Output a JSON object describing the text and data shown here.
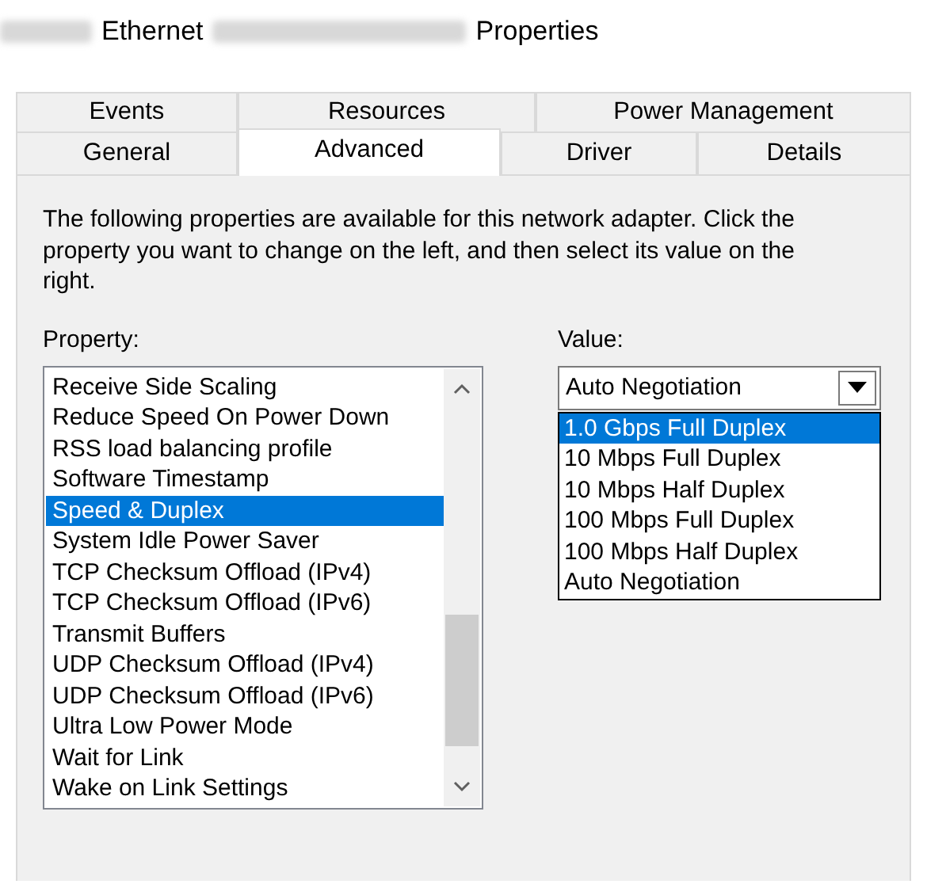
{
  "window": {
    "title_parts": [
      {
        "kind": "redacted"
      },
      {
        "kind": "text",
        "text": "Ethernet"
      },
      {
        "kind": "redacted"
      },
      {
        "kind": "text",
        "text": "Properties"
      }
    ]
  },
  "tab_rows": [
    [
      {
        "label": "Events",
        "selected": false
      },
      {
        "label": "Resources",
        "selected": false
      },
      {
        "label": "Power Management",
        "selected": false
      }
    ],
    [
      {
        "label": "General",
        "selected": false
      },
      {
        "label": "Advanced",
        "selected": true
      },
      {
        "label": "Driver",
        "selected": false
      },
      {
        "label": "Details",
        "selected": false
      }
    ]
  ],
  "description": "The following properties are available for this network adapter. Click the property you want to change on the left, and then select its value on the right.",
  "property": {
    "label": "Property:",
    "items": [
      {
        "label": "Receive Side Scaling",
        "selected": false
      },
      {
        "label": "Reduce Speed On Power Down",
        "selected": false
      },
      {
        "label": "RSS load balancing profile",
        "selected": false
      },
      {
        "label": "Software Timestamp",
        "selected": false
      },
      {
        "label": "Speed & Duplex",
        "selected": true
      },
      {
        "label": "System Idle Power Saver",
        "selected": false
      },
      {
        "label": "TCP Checksum Offload (IPv4)",
        "selected": false
      },
      {
        "label": "TCP Checksum Offload (IPv6)",
        "selected": false
      },
      {
        "label": "Transmit Buffers",
        "selected": false
      },
      {
        "label": "UDP Checksum Offload (IPv4)",
        "selected": false
      },
      {
        "label": "UDP Checksum Offload (IPv6)",
        "selected": false
      },
      {
        "label": "Ultra Low Power Mode",
        "selected": false
      },
      {
        "label": "Wait for Link",
        "selected": false
      },
      {
        "label": "Wake on Link Settings",
        "selected": false
      }
    ]
  },
  "value": {
    "label": "Value:",
    "current": "Auto Negotiation",
    "expanded": true,
    "options": [
      {
        "label": "1.0 Gbps Full Duplex",
        "highlighted": true
      },
      {
        "label": "10 Mbps Full Duplex",
        "highlighted": false
      },
      {
        "label": "10 Mbps Half Duplex",
        "highlighted": false
      },
      {
        "label": "100 Mbps Full Duplex",
        "highlighted": false
      },
      {
        "label": "100 Mbps Half Duplex",
        "highlighted": false
      },
      {
        "label": "Auto Negotiation",
        "highlighted": false
      }
    ]
  }
}
